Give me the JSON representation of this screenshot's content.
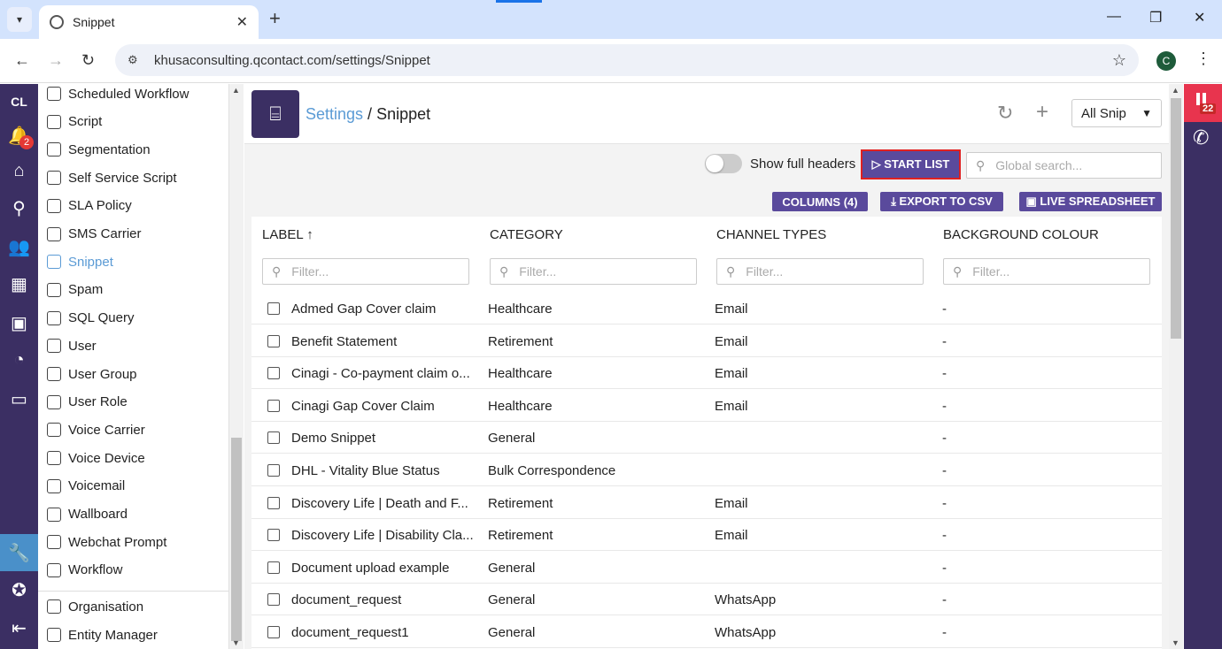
{
  "browser": {
    "tab_title": "Snippet",
    "url": "khusaconsulting.qcontact.com/settings/Snippet",
    "profile_initial": "C"
  },
  "rail": {
    "brand": "CL",
    "notification_count": "2"
  },
  "menu": {
    "items": [
      {
        "label": "Scheduled Workflow",
        "icon": "workflow-icon"
      },
      {
        "label": "Script",
        "icon": "script-icon"
      },
      {
        "label": "Segmentation",
        "icon": "segmentation-icon"
      },
      {
        "label": "Self Service Script",
        "icon": "robot-icon"
      },
      {
        "label": "SLA Policy",
        "icon": "sla-icon"
      },
      {
        "label": "SMS Carrier",
        "icon": "phone-icon"
      },
      {
        "label": "Snippet",
        "icon": "snippet-icon",
        "selected": true
      },
      {
        "label": "Spam",
        "icon": "spam-icon"
      },
      {
        "label": "SQL Query",
        "icon": "table-icon"
      },
      {
        "label": "User",
        "icon": "user-icon"
      },
      {
        "label": "User Group",
        "icon": "user-group-icon"
      },
      {
        "label": "User Role",
        "icon": "user-role-icon"
      },
      {
        "label": "Voice Carrier",
        "icon": "network-icon"
      },
      {
        "label": "Voice Device",
        "icon": "device-icon"
      },
      {
        "label": "Voicemail",
        "icon": "voicemail-icon"
      },
      {
        "label": "Wallboard",
        "icon": "monitor-icon"
      },
      {
        "label": "Webchat Prompt",
        "icon": "chat-icon"
      },
      {
        "label": "Workflow",
        "icon": "send-icon"
      }
    ],
    "bottom_items": [
      {
        "label": "Organisation",
        "icon": "sliders-icon"
      },
      {
        "label": "Entity Manager",
        "icon": "tools-icon"
      }
    ]
  },
  "header": {
    "crumb_link": "Settings",
    "crumb_sep": " / ",
    "crumb_current": "Snippet",
    "view_select": "All Snip"
  },
  "toolbar": {
    "toggle_label": "Show full headers",
    "start_list": "▷ START LIST",
    "search_placeholder": "Global search...",
    "columns": "COLUMNS (4)",
    "export": "⤓ EXPORT TO CSV",
    "live": "▣ LIVE SPREADSHEET"
  },
  "table": {
    "columns": [
      "LABEL ↑",
      "CATEGORY",
      "CHANNEL TYPES",
      "BACKGROUND COLOUR"
    ],
    "filter_placeholder": "Filter...",
    "rows": [
      {
        "label": "Admed Gap Cover claim",
        "category": "Healthcare",
        "channel": "Email",
        "bg": "-"
      },
      {
        "label": "Benefit Statement",
        "category": "Retirement",
        "channel": "Email",
        "bg": "-"
      },
      {
        "label": "Cinagi - Co-payment claim o...",
        "category": "Healthcare",
        "channel": "Email",
        "bg": "-"
      },
      {
        "label": "Cinagi Gap Cover Claim",
        "category": "Healthcare",
        "channel": "Email",
        "bg": "-"
      },
      {
        "label": "Demo Snippet",
        "category": "General",
        "channel": "",
        "bg": "-"
      },
      {
        "label": "DHL - Vitality Blue Status",
        "category": "Bulk Correspondence",
        "channel": "",
        "bg": "-"
      },
      {
        "label": "Discovery Life | Death and F...",
        "category": "Retirement",
        "channel": "Email",
        "bg": "-"
      },
      {
        "label": "Discovery Life | Disability Cla...",
        "category": "Retirement",
        "channel": "Email",
        "bg": "-"
      },
      {
        "label": "Document upload example",
        "category": "General",
        "channel": "",
        "bg": "-"
      },
      {
        "label": "document_request",
        "category": "General",
        "channel": "WhatsApp",
        "bg": "-"
      },
      {
        "label": "document_request1",
        "category": "General",
        "channel": "WhatsApp",
        "bg": "-"
      }
    ]
  },
  "right_rail": {
    "badge_count": "22"
  },
  "colors": {
    "brand": "#3b2f63",
    "accent_button": "#5a4a9c",
    "link": "#5b9bd5",
    "highlight_border": "#e02020"
  }
}
